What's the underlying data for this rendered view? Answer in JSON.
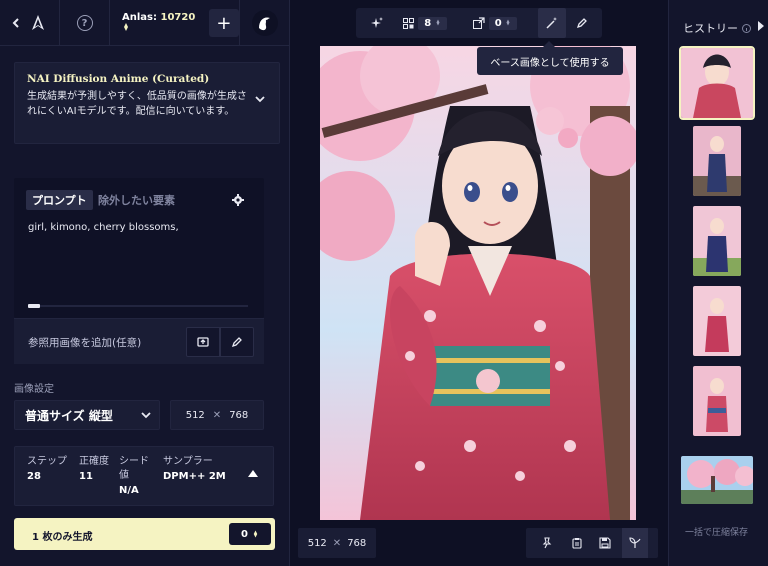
{
  "topbar": {
    "anlas_label": "Anlas:",
    "anlas_value": "10720",
    "plus_label": "+",
    "help_label": "?"
  },
  "model": {
    "name": "NAI Diffusion Anime (Curated)",
    "description": "生成結果が予測しやすく、低品質の画像が生成されにくいAIモデルです。配信に向いています。"
  },
  "prompt": {
    "tab_prompt": "プロンプト",
    "tab_negative": "除外したい要素",
    "text": "girl, kimono, cherry blossoms,"
  },
  "reference": {
    "label": "参照用画像を追加(任意)"
  },
  "image_settings": {
    "section_label": "画像設定",
    "size_preset": "普通サイズ 縦型",
    "width": "512",
    "height": "768",
    "times": "✕"
  },
  "params": {
    "steps_label": "ステップ",
    "steps_value": "28",
    "scale_label": "正確度",
    "scale_value": "11",
    "seed_label_1": "シード",
    "seed_label_2": "値",
    "seed_value": "N/A",
    "sampler_label": "サンプラー",
    "sampler_value": "DPM++ 2M"
  },
  "generate": {
    "label": "1 枚のみ生成",
    "cost": "0"
  },
  "center_toolbar": {
    "variations_count": "8",
    "upscale_count": "0"
  },
  "tooltip": "ベース画像として使用する",
  "canvas": {
    "width": "512",
    "height": "768",
    "times": "✕"
  },
  "history": {
    "title": "ヒストリー",
    "save_all": "一括で圧縮保存",
    "thumbnails": [
      "kimono-girl-1",
      "kimono-girl-2",
      "kimono-girl-3",
      "kimono-girl-4",
      "kimono-girl-5",
      "cherry-landscape"
    ]
  },
  "colors": {
    "background": "#0e1024",
    "panel": "#13152c",
    "accent": "#f5f3c2",
    "box": "#1a1d35"
  }
}
